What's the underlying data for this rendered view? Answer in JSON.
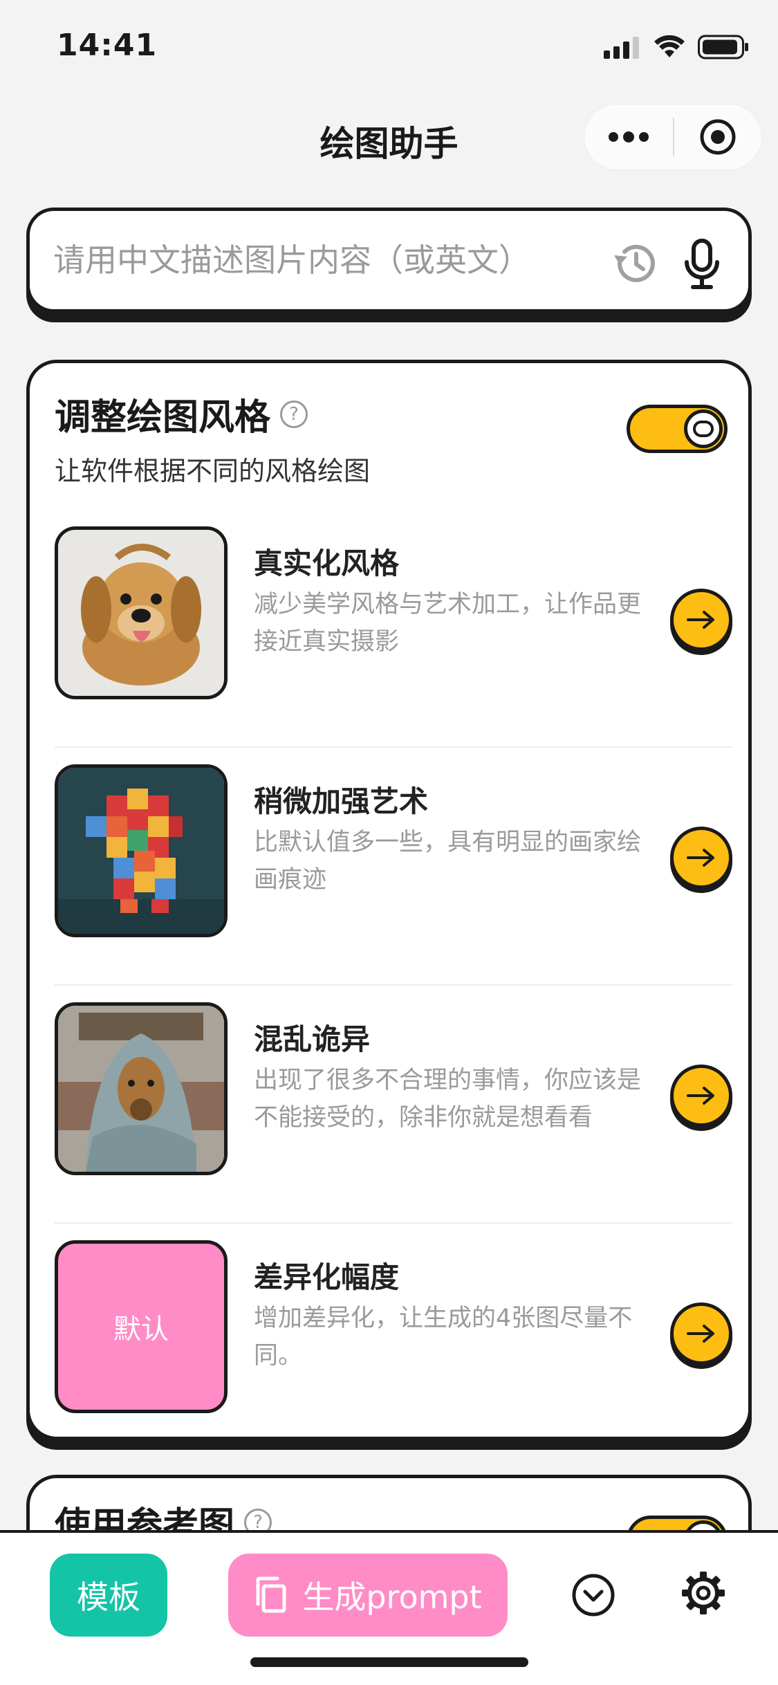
{
  "status_bar": {
    "time": "14:41"
  },
  "nav": {
    "title": "绘图助手"
  },
  "search": {
    "placeholder": "请用中文描述图片内容（或英文）"
  },
  "style_card": {
    "title": "调整绘图风格",
    "subtitle": "让软件根据不同的风格绘图",
    "help": "?",
    "toggle_on": true,
    "items": [
      {
        "title": "真实化风格",
        "desc": "减少美学风格与艺术加工，让作品更接近真实摄影"
      },
      {
        "title": "稍微加强艺术",
        "desc": "比默认值多一些，具有明显的画家绘画痕迹"
      },
      {
        "title": "混乱诡异",
        "desc": "出现了很多不合理的事情，你应该是不能接受的，除非你就是想看看"
      },
      {
        "title": "差异化幅度",
        "desc": "增加差异化，让生成的4张图尽量不同。",
        "thumb_label": "默认"
      }
    ]
  },
  "reference_card": {
    "title": "使用参考图",
    "help": "?"
  },
  "bottom_bar": {
    "template_label": "模板",
    "generate_label": "生成prompt"
  },
  "colors": {
    "accent_yellow": "#fdbd12",
    "accent_teal": "#14c4a6",
    "accent_pink": "#ff8cc6",
    "outline": "#1a1a1a"
  }
}
